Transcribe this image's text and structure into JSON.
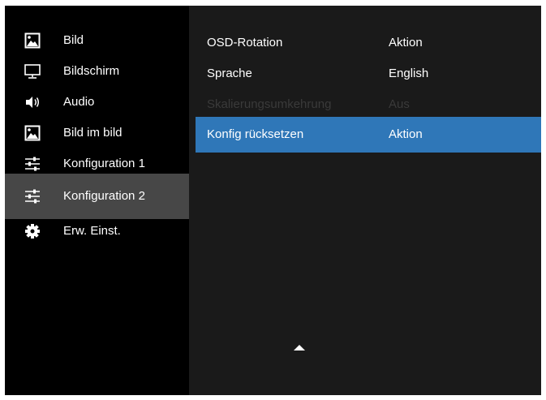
{
  "sidebar": {
    "items": [
      {
        "label": "Bild",
        "icon": "picture-icon"
      },
      {
        "label": "Bildschirm",
        "icon": "monitor-icon"
      },
      {
        "label": "Audio",
        "icon": "speaker-icon"
      },
      {
        "label": "Bild im bild",
        "icon": "picture-in-picture-icon"
      },
      {
        "label": "Konfiguration 1",
        "icon": "sliders-icon"
      },
      {
        "label": "Konfiguration 2",
        "icon": "sliders-icon",
        "selected": true
      },
      {
        "label": "Erw. Einst.",
        "icon": "gear-icon"
      }
    ]
  },
  "main": {
    "rows": [
      {
        "name": "OSD-Rotation",
        "value": "Aktion",
        "state": "normal"
      },
      {
        "name": "Sprache",
        "value": "English",
        "state": "normal"
      },
      {
        "name": "Skalierungsumkehrung",
        "value": "Aus",
        "state": "disabled"
      },
      {
        "name": "Konfig rücksetzen",
        "value": "Aktion",
        "state": "highlighted"
      }
    ],
    "scroll_indicator": "scroll-up-arrow-icon"
  },
  "colors": {
    "sidebar_bg": "#000000",
    "selected_bg": "#474747",
    "main_bg": "#1a1a1a",
    "highlight": "#2f77b8",
    "disabled_text": "#3a3a3a",
    "text": "#ffffff"
  }
}
